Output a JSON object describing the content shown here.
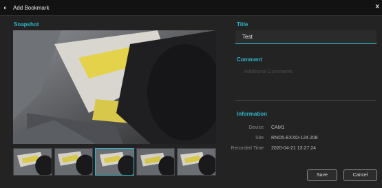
{
  "window": {
    "title": "Add Bookmark",
    "close_glyph": "x"
  },
  "snapshot": {
    "label": "Snapshot",
    "thumbnail_count": 5,
    "selected_thumbnail": 3
  },
  "title": {
    "label": "Title",
    "value": "Test"
  },
  "comment": {
    "label": "Comment",
    "placeholder": "Additional Comments"
  },
  "information": {
    "label": "Information",
    "rows": [
      {
        "key": "Device",
        "value": "CAM1"
      },
      {
        "key": "Site",
        "value": "RND5.EXXD-124.208"
      },
      {
        "key": "Recorded Time",
        "value": "2020-04-21 13:27:24"
      }
    ]
  },
  "buttons": {
    "save": "Save",
    "cancel": "Cancel"
  },
  "colors": {
    "accent": "#2fb6c9",
    "background": "#232323",
    "titlebar": "#121212"
  }
}
